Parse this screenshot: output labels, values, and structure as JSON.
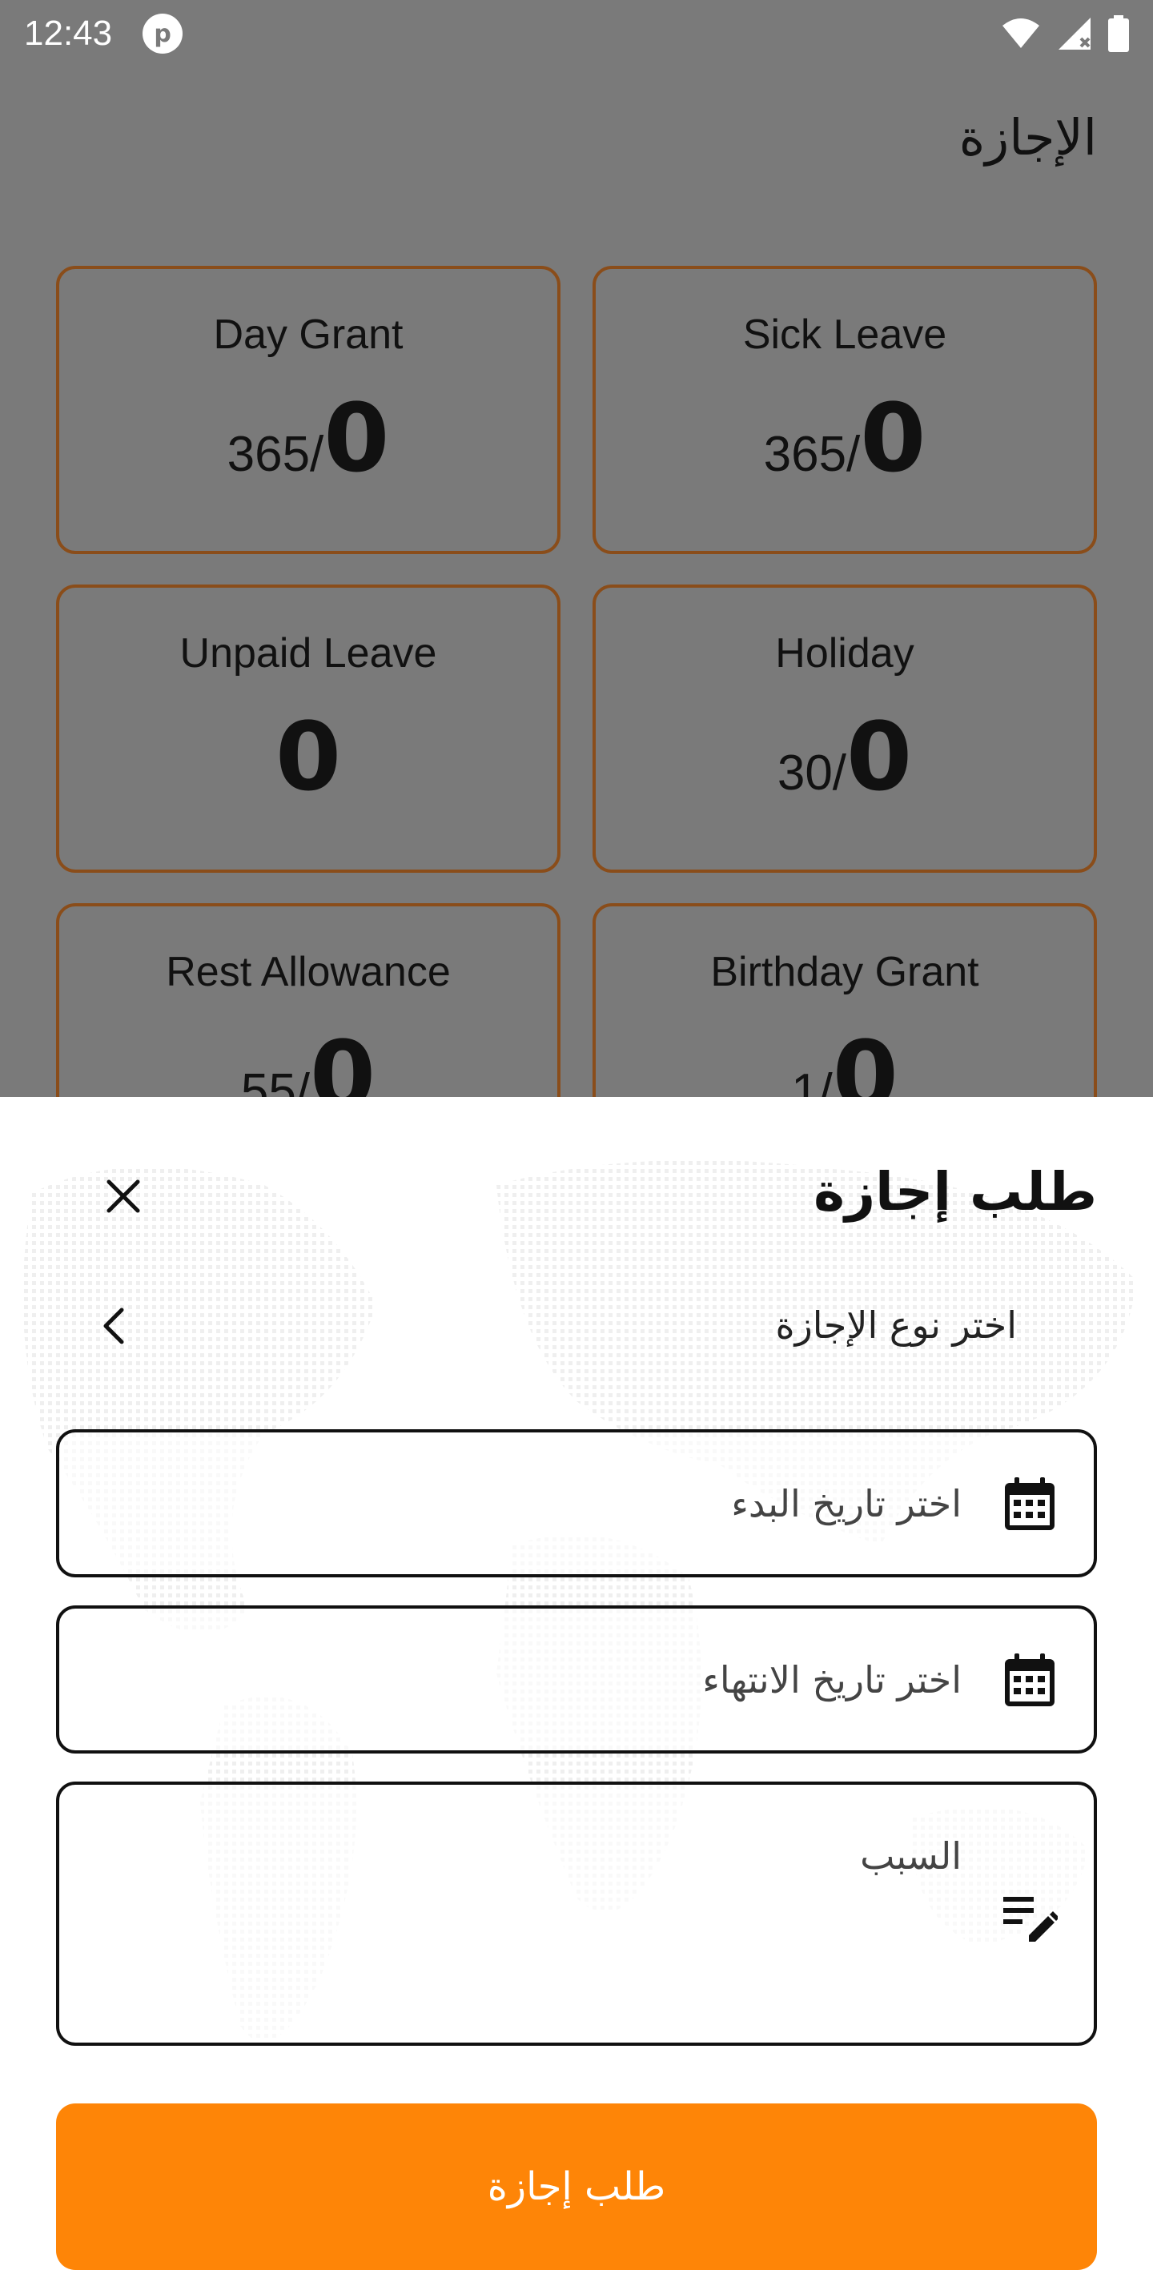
{
  "status_bar": {
    "time": "12:43",
    "app_icon": "p"
  },
  "page": {
    "title": "الإجازة"
  },
  "balances": [
    {
      "label": "Day Grant",
      "total": "365/",
      "used": "0"
    },
    {
      "label": "Sick Leave",
      "total": "365/",
      "used": "0"
    },
    {
      "label": "Unpaid Leave",
      "total": "",
      "used": "0"
    },
    {
      "label": "Holiday",
      "total": "30/",
      "used": "0"
    },
    {
      "label": "Rest Allowance",
      "total": "55/",
      "used": "0"
    },
    {
      "label": "Birthday Grant",
      "total": "1/",
      "used": "0"
    }
  ],
  "sheet": {
    "title": "طلب إجازة",
    "leave_type_placeholder": "اختر نوع الإجازة",
    "start_date_placeholder": "اختر تاريخ البدء",
    "end_date_placeholder": "اختر تاريخ الانتهاء",
    "reason_placeholder": "السبب",
    "submit_label": "طلب إجازة"
  },
  "colors": {
    "overlay": "#7a7a7a",
    "card_border": "#8a4d1a",
    "accent": "#fe8507",
    "sheet_bg": "#ffffff"
  },
  "icons": [
    "wifi-icon",
    "signal-icon",
    "battery-icon",
    "close-icon",
    "chevron-left-icon",
    "calendar-icon",
    "edit-note-icon"
  ]
}
